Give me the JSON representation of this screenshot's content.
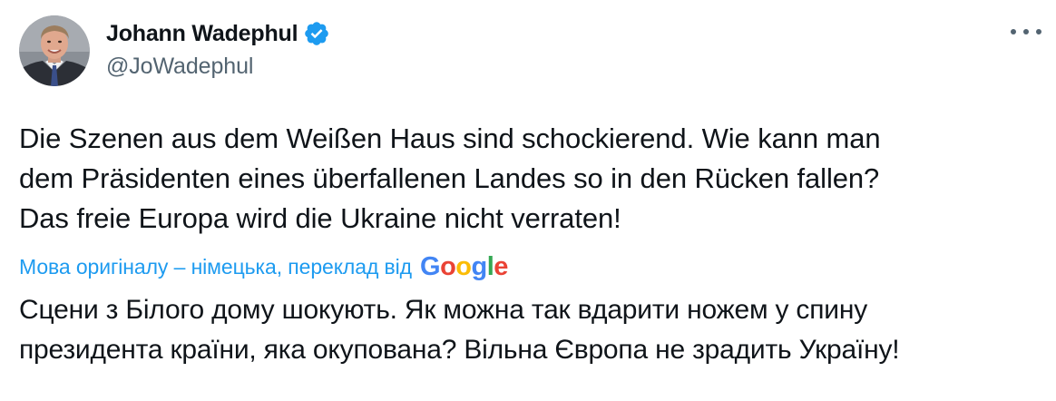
{
  "author": {
    "display_name": "Johann Wadephul",
    "handle": "@JoWadephul",
    "verified": true,
    "avatar_icon": "user-avatar-photo"
  },
  "more_icon": "more-horizontal-icon",
  "tweet": {
    "original_lines": [
      "Die Szenen aus dem Weißen Haus sind schockierend. Wie kann man",
      "dem Präsidenten eines überfallenen Landes so in den Rücken fallen?",
      "Das freie Europa wird die Ukraine nicht verraten!"
    ],
    "translation_label": "Мова оригіналу – німецька, переклад від",
    "translation_provider": {
      "letters": [
        "G",
        "o",
        "o",
        "g",
        "l",
        "e"
      ]
    },
    "translated_lines": [
      "Сцени з Білого дому шокують. Як можна так вдарити ножем у спину",
      "президента країни, яка окупована? Вільна Європа не зрадить Україну!"
    ]
  },
  "colors": {
    "text": "#0f1419",
    "secondary": "#536471",
    "link": "#1d9bf0",
    "verified": "#1d9bf0",
    "google_blue": "#4285f4",
    "google_red": "#ea4335",
    "google_yellow": "#fbbc05",
    "google_green": "#34a853"
  }
}
